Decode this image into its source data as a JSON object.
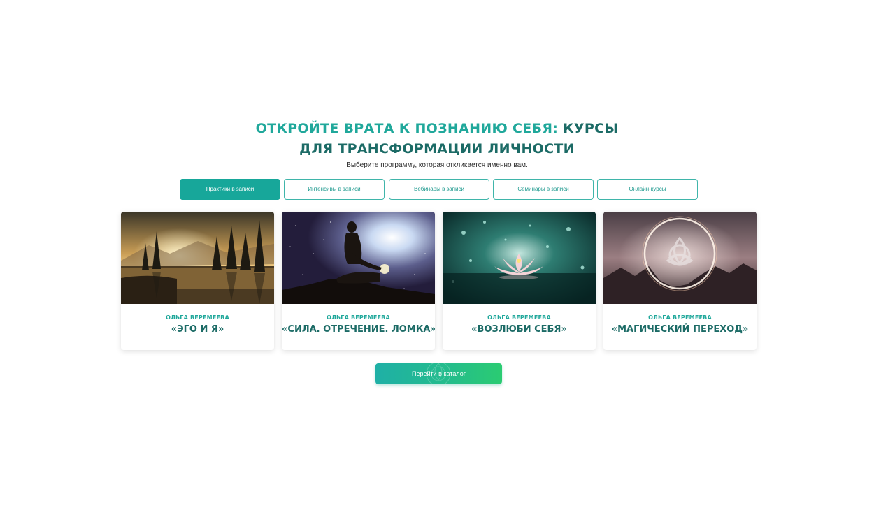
{
  "section": {
    "heading_accent": "Откройте врата к познанию себя:",
    "heading_rest_line1": "курсы",
    "heading_line2": "для трансформации личности",
    "subtitle": "Выберите программу, которая откликается именно вам."
  },
  "tabs": [
    {
      "label": "Практики в записи",
      "active": true
    },
    {
      "label": "Интенсивы в записи",
      "active": false
    },
    {
      "label": "Вебинары в записи",
      "active": false
    },
    {
      "label": "Семинары в записи",
      "active": false
    },
    {
      "label": "Онлайн-курсы",
      "active": false
    }
  ],
  "cards": [
    {
      "author": "Ольга Веремеева",
      "title": "«Эго и Я»",
      "image": "misty-lake-sunrise"
    },
    {
      "author": "Ольга Веремеева",
      "title": "«Сила. Отречение. Ломка»",
      "image": "meditating-woman-galaxy"
    },
    {
      "author": "Ольга Веремеева",
      "title": "«Возлюби себя»",
      "image": "lotus-on-water"
    },
    {
      "author": "Ольга Веремеева",
      "title": "«Магический переход»",
      "image": "glowing-triquetra-circle"
    }
  ],
  "cta": {
    "label": "Перейти в каталог"
  },
  "colors": {
    "accent": "#20a89b",
    "dark_teal": "#1c6b66",
    "button_gradient_start": "#1fb0a6",
    "button_gradient_end": "#2bcc72"
  }
}
